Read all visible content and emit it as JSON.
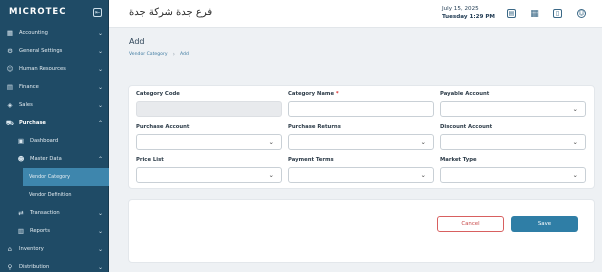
{
  "brand": {
    "logo": "MICROTEC"
  },
  "header": {
    "company": "فرع جدة  شركة جدة",
    "date": "July 15, 2025",
    "day_time": "Tuesday  1:29 PM"
  },
  "sidebar": {
    "items": [
      {
        "label": "Accounting",
        "icon": "calculator-icon"
      },
      {
        "label": "General Settings",
        "icon": "gear-icon"
      },
      {
        "label": "Human Resources",
        "icon": "people-icon"
      },
      {
        "label": "Finance",
        "icon": "finance-icon"
      },
      {
        "label": "Sales",
        "icon": "sales-icon"
      },
      {
        "label": "Purchase",
        "icon": "cart-icon"
      },
      {
        "label": "Dashboard",
        "icon": "dashboard-icon"
      },
      {
        "label": "Master Data",
        "icon": "person-icon"
      },
      {
        "label": "Vendor Category"
      },
      {
        "label": "Vendor Definition"
      },
      {
        "label": "Transaction",
        "icon": "transaction-icon"
      },
      {
        "label": "Reports",
        "icon": "reports-icon"
      },
      {
        "label": "Inventory",
        "icon": "inventory-icon"
      },
      {
        "label": "Distribution",
        "icon": "distribution-icon"
      }
    ]
  },
  "page": {
    "title": "Add",
    "breadcrumb": [
      "Vendor Category",
      "Add"
    ]
  },
  "form": {
    "category_code": "Category Code",
    "category_name": "Category Name",
    "required_mark": "*",
    "payable_account": "Payable Account",
    "purchase_account": "Purchase Account",
    "purchase_returns": "Purchase Returns",
    "discount_account": "Discount Account",
    "price_list": "Price List",
    "payment_terms": "Payment Terms",
    "market_type": "Market Type"
  },
  "actions": {
    "cancel": "Cancel",
    "save": "Save"
  }
}
